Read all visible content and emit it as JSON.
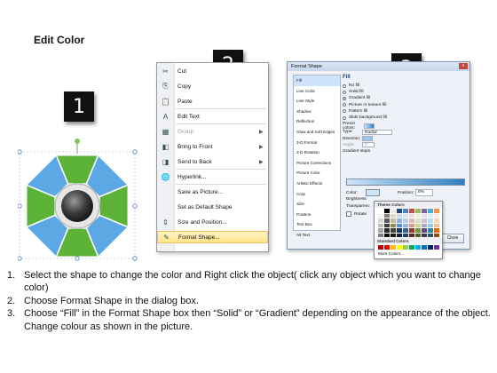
{
  "title": "Edit Color",
  "badges": [
    "1",
    "2",
    "3"
  ],
  "diagram": {
    "name": "octagon-diagram",
    "colors": {
      "green": "#5cb337",
      "blue": "#5ba8e4",
      "center": "#3a3a3a"
    }
  },
  "context_menu": {
    "items": [
      {
        "icon": "cut-icon",
        "glyph": "✂",
        "label": "Cut"
      },
      {
        "icon": "copy-icon",
        "glyph": "⎘",
        "label": "Copy"
      },
      {
        "icon": "paste-icon",
        "glyph": "📋",
        "label": "Paste"
      },
      {
        "icon": "edit-text-icon",
        "glyph": "A",
        "label": "Edit Text"
      },
      {
        "icon": "group-icon",
        "glyph": "▦",
        "label": "Group",
        "disabled": true,
        "submenu": true
      },
      {
        "icon": "bring-front-icon",
        "glyph": "◧",
        "label": "Bring to Front",
        "submenu": true
      },
      {
        "icon": "send-back-icon",
        "glyph": "◨",
        "label": "Send to Back",
        "submenu": true
      },
      {
        "icon": "hyperlink-icon",
        "glyph": "🌐",
        "label": "Hyperlink..."
      },
      {
        "icon": "save-picture-icon",
        "glyph": "",
        "label": "Save as Picture..."
      },
      {
        "icon": "default-shape-icon",
        "glyph": "",
        "label": "Set as Default Shape"
      },
      {
        "icon": "size-position-icon",
        "glyph": "⇕",
        "label": "Size and Position..."
      },
      {
        "icon": "format-shape-icon",
        "glyph": "✎",
        "label": "Format Shape...",
        "highlighted": true
      }
    ]
  },
  "dialog": {
    "title": "Format Shape",
    "close_glyph": "x",
    "nav": [
      "Fill",
      "Line Color",
      "Line Style",
      "Shadow",
      "Reflection",
      "Glow and Soft Edges",
      "3-D Format",
      "3-D Rotation",
      "Picture Corrections",
      "Picture Color",
      "Artistic Effects",
      "Crop",
      "Size",
      "Position",
      "Text Box",
      "Alt Text"
    ],
    "pane_title": "Fill",
    "fill_options": [
      {
        "label": "No fill",
        "selected": false
      },
      {
        "label": "Solid fill",
        "selected": false
      },
      {
        "label": "Gradient fill",
        "selected": true
      },
      {
        "label": "Picture or texture fill",
        "selected": false
      },
      {
        "label": "Pattern fill",
        "selected": false
      },
      {
        "label": "Slide background fill",
        "selected": false
      }
    ],
    "preset_colors_label": "Preset colors:",
    "type_label": "Type:",
    "type_value": "Radial",
    "direction_label": "Direction:",
    "angle_label": "Angle:",
    "angle_value": "0°",
    "gradient_stops_label": "Gradient stops",
    "color_label": "Color:",
    "position_label": "Position:",
    "position_value": "0%",
    "brightness_label": "Brightness",
    "transparency_label": "Transparenc",
    "rotate_label": "Rotate",
    "close_label": "Close"
  },
  "palette": {
    "theme_title": "Theme Colors",
    "standard_title": "Standard Colors",
    "more_label": "More Colors...",
    "theme_top": [
      "#ffffff",
      "#000000",
      "#eeece1",
      "#1f497d",
      "#4f81bd",
      "#c0504d",
      "#9bbb59",
      "#8064a2",
      "#4bacc6",
      "#f79646"
    ],
    "theme_shades": [
      [
        "#f2f2f2",
        "#7f7f7f",
        "#ddd9c3",
        "#c6d9f0",
        "#dbe5f1",
        "#f2dcdb",
        "#ebf1dd",
        "#e5e0ec",
        "#dbeef3",
        "#fdeada"
      ],
      [
        "#d8d8d8",
        "#595959",
        "#c4bd97",
        "#8db3e2",
        "#b8cce4",
        "#e5b9b7",
        "#d7e3bc",
        "#ccc1d9",
        "#b7dde8",
        "#fbd5b5"
      ],
      [
        "#bfbfbf",
        "#3f3f3f",
        "#938953",
        "#548dd4",
        "#95b3d7",
        "#d99694",
        "#c3d69b",
        "#b2a2c7",
        "#92cddc",
        "#fac08f"
      ],
      [
        "#a5a5a5",
        "#262626",
        "#494429",
        "#17365d",
        "#366092",
        "#953734",
        "#76923c",
        "#5f497a",
        "#31859b",
        "#e36c09"
      ],
      [
        "#7f7f7f",
        "#0c0c0c",
        "#1d1b10",
        "#0f243e",
        "#244061",
        "#632423",
        "#4f6128",
        "#3f3151",
        "#205867",
        "#974806"
      ]
    ],
    "standard": [
      "#c00000",
      "#ff0000",
      "#ffc000",
      "#ffff00",
      "#92d050",
      "#00b050",
      "#00b0f0",
      "#0070c0",
      "#002060",
      "#7030a0"
    ]
  },
  "instructions": [
    {
      "num": "1.",
      "text": "Select the shape to change the color and Right click the object( click any object which you want to change color)"
    },
    {
      "num": "2.",
      "text": "Choose Format Shape in the dialog box."
    },
    {
      "num": "3.",
      "text": "Choose “Fill” in the Format Shape box then “Solid” or “Gradient” depending on the appearance of the object. Change colour as shown in the picture."
    }
  ]
}
